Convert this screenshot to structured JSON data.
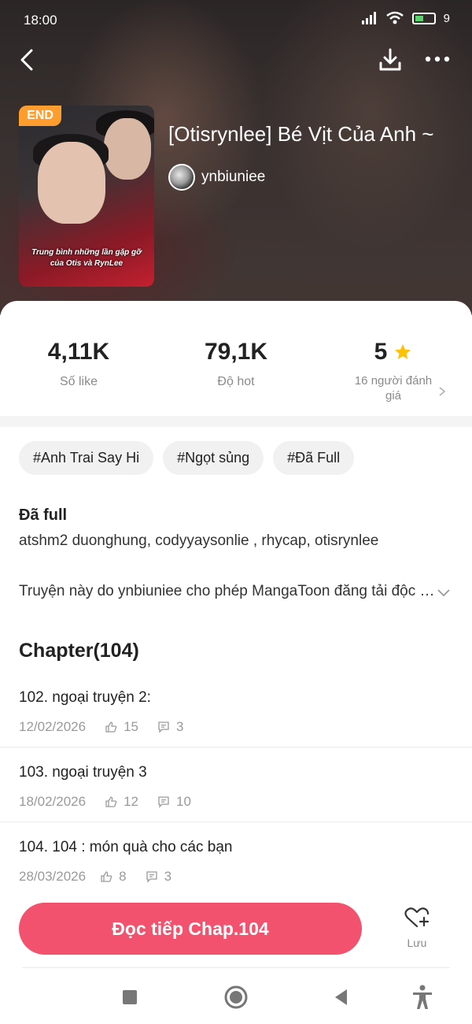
{
  "status_bar": {
    "time": "18:00",
    "battery": "9"
  },
  "manga": {
    "badge": "END",
    "title": "[Otisrynlee] Bé Vịt Của Anh ~",
    "author": "ynbiuniee",
    "cover_caption": "Trung bình những lần gặp gỡ của Otis và RynLee"
  },
  "stats": {
    "likes": {
      "value": "4,11K",
      "label": "Số like"
    },
    "hot": {
      "value": "79,1K",
      "label": "Độ hot"
    },
    "rating": {
      "value": "5",
      "label": "16 người đánh giá"
    }
  },
  "tags": [
    "#Anh Trai Say Hi",
    "#Ngọt sủng",
    "#Đã Full"
  ],
  "description": {
    "status": "Đã full",
    "authors_line": "atshm2 duonghung, codyyaysonlie , rhycap, otisrynlee",
    "notice": "Truyện này do ynbiuniee cho phép MangaToon đăng tải độc quyền"
  },
  "chapters_header": "Chapter(104)",
  "chapters": [
    {
      "title": "102. ngoại truyện 2:",
      "date": "12/02/2026",
      "likes": "15",
      "comments": "3"
    },
    {
      "title": "103. ngoại truyện 3",
      "date": "18/02/2026",
      "likes": "12",
      "comments": "10"
    },
    {
      "title": "104. 104 : món quà cho các bạn",
      "date": "28/03/2026",
      "likes": "8",
      "comments": "3"
    }
  ],
  "actions": {
    "read_label": "Đọc tiếp Chap.104",
    "save_label": "Lưu"
  },
  "colors": {
    "accent": "#f2526d",
    "badge": "#ff9e2e",
    "star": "#ffc107"
  }
}
